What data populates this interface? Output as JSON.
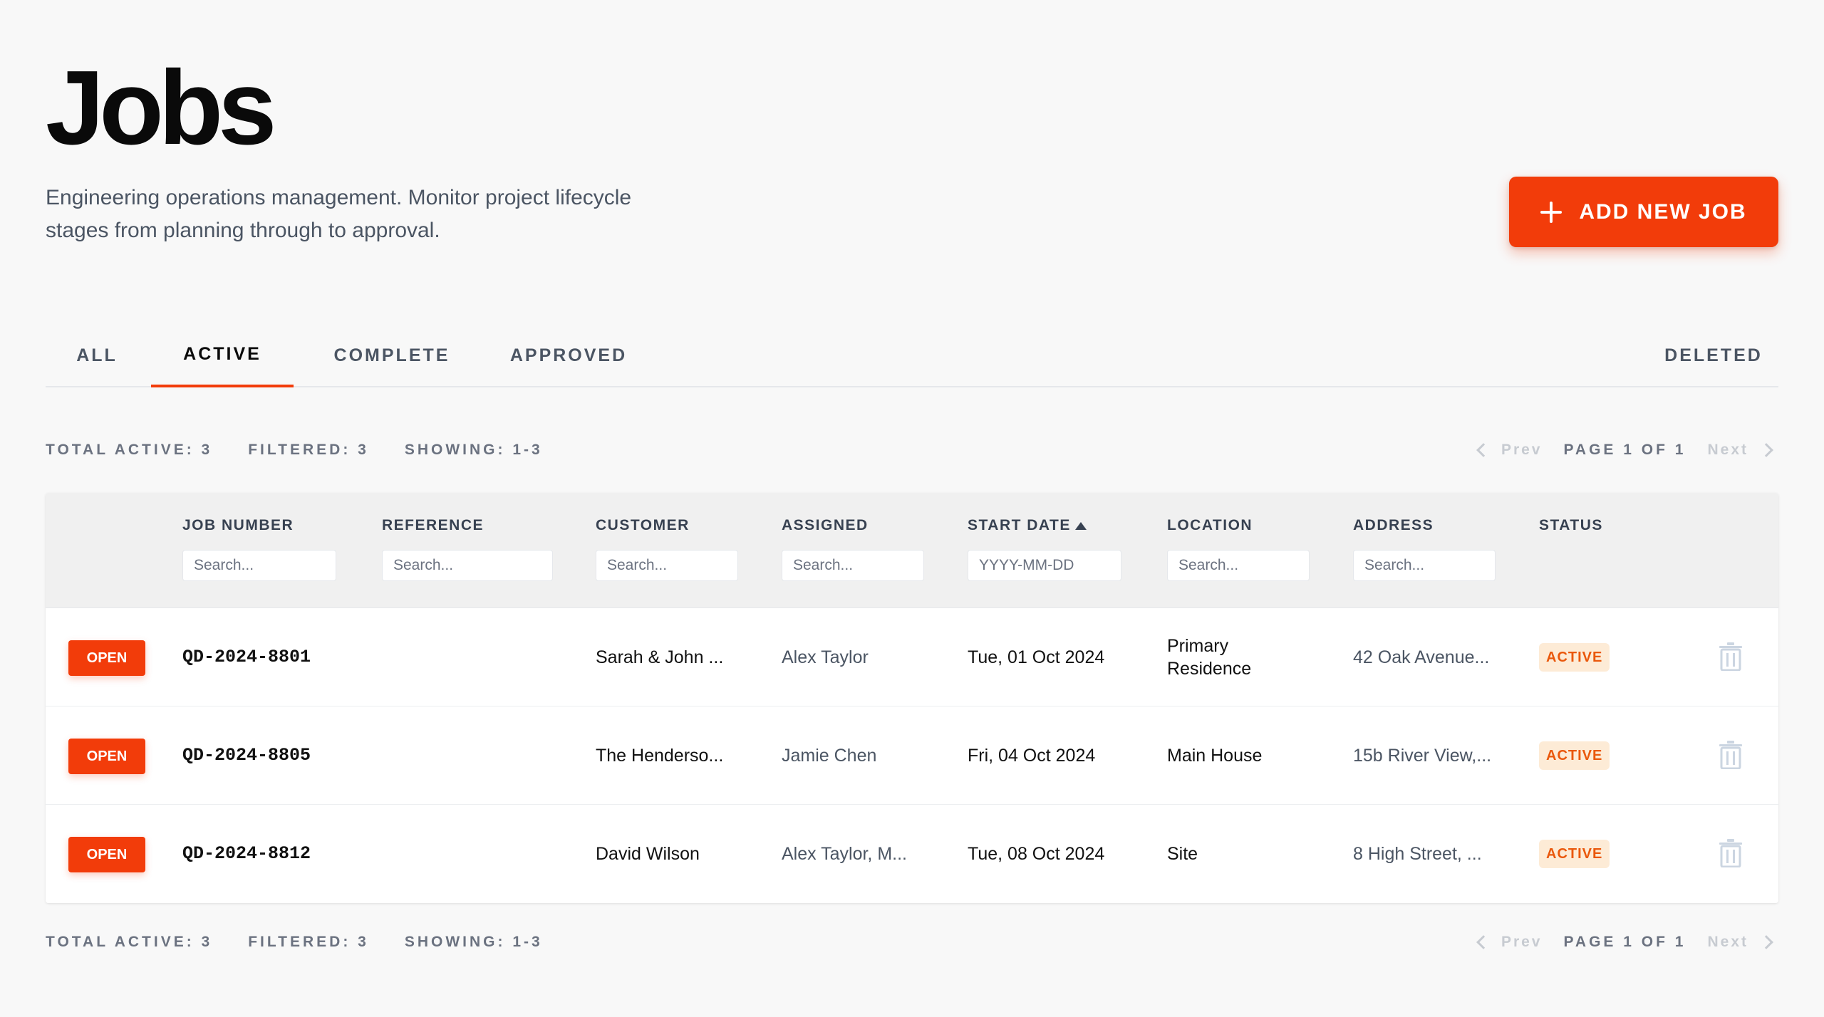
{
  "header": {
    "title": "Jobs",
    "subtitle": "Engineering operations management. Monitor project lifecycle stages from planning through to approval.",
    "add_button_label": "ADD NEW JOB"
  },
  "tabs": [
    {
      "label": "ALL",
      "active": false
    },
    {
      "label": "ACTIVE",
      "active": true
    },
    {
      "label": "COMPLETE",
      "active": false
    },
    {
      "label": "APPROVED",
      "active": false
    },
    {
      "label": "DELETED",
      "active": false
    }
  ],
  "summary": {
    "total": "TOTAL ACTIVE: 3",
    "filtered": "FILTERED: 3",
    "showing": "SHOWING: 1-3",
    "prev_label": "Prev",
    "page_info": "PAGE 1 OF 1",
    "next_label": "Next"
  },
  "columns": [
    {
      "label": "JOB NUMBER",
      "placeholder": "Search..."
    },
    {
      "label": "REFERENCE",
      "placeholder": "Search..."
    },
    {
      "label": "CUSTOMER",
      "placeholder": "Search..."
    },
    {
      "label": "ASSIGNED",
      "placeholder": "Search..."
    },
    {
      "label": "START DATE",
      "placeholder": "YYYY-MM-DD",
      "sorted": "asc"
    },
    {
      "label": "LOCATION",
      "placeholder": "Search..."
    },
    {
      "label": "ADDRESS",
      "placeholder": "Search..."
    },
    {
      "label": "STATUS"
    }
  ],
  "rows": [
    {
      "action": "OPEN",
      "job_number": "QD-2024-8801",
      "reference": "",
      "customer": "Sarah & John ...",
      "assigned": "Alex Taylor",
      "start_date": "Tue, 01 Oct 2024",
      "location": "Primary Residence",
      "address": "42 Oak Avenue...",
      "status": "ACTIVE"
    },
    {
      "action": "OPEN",
      "job_number": "QD-2024-8805",
      "reference": "",
      "customer": "The Henderso...",
      "assigned": "Jamie Chen",
      "start_date": "Fri, 04 Oct 2024",
      "location": "Main House",
      "address": "15b River View,...",
      "status": "ACTIVE"
    },
    {
      "action": "OPEN",
      "job_number": "QD-2024-8812",
      "reference": "",
      "customer": "David Wilson",
      "assigned": "Alex Taylor, M...",
      "start_date": "Tue, 08 Oct 2024",
      "location": "Site",
      "address": "8 High Street, ...",
      "status": "ACTIVE"
    }
  ],
  "colors": {
    "accent": "#f23c0a",
    "badge_bg": "#fdebd6",
    "badge_text": "#ea580c"
  }
}
